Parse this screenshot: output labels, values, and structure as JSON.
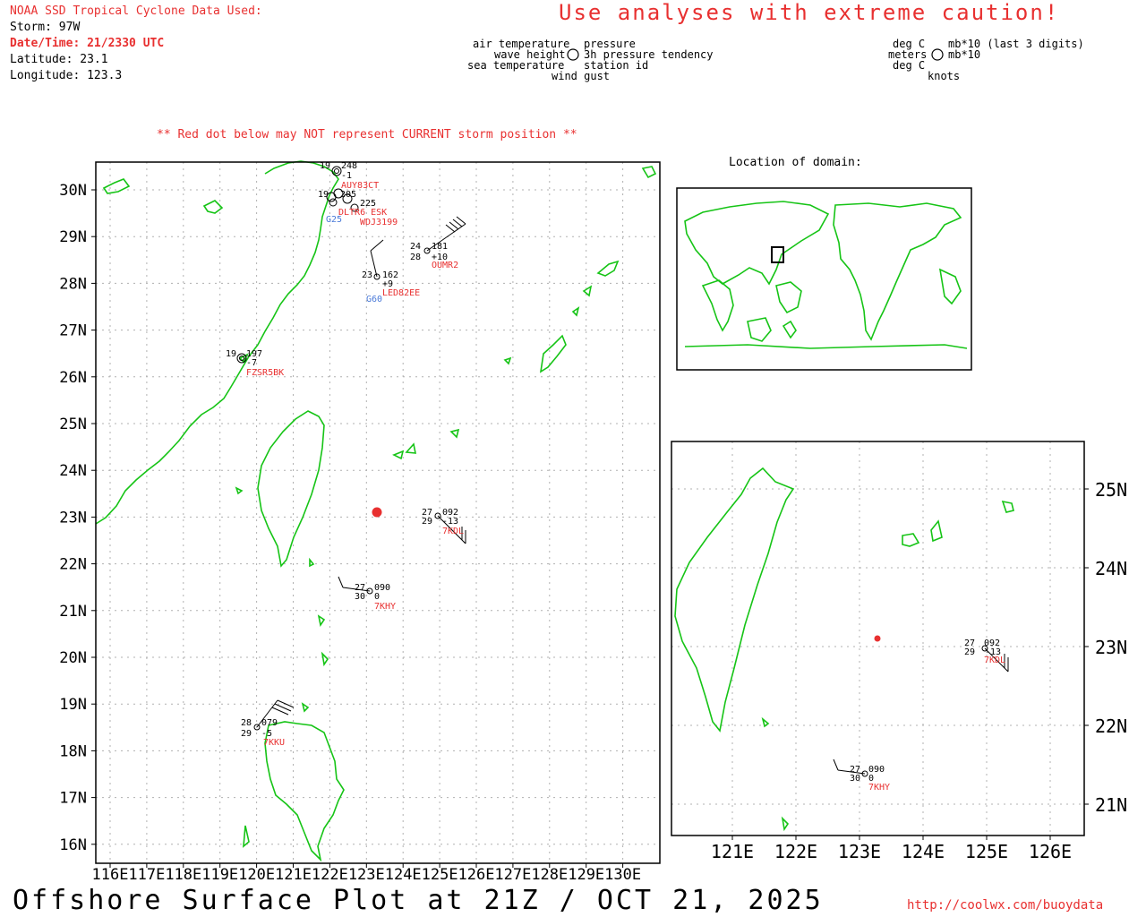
{
  "header": {
    "source": "NOAA SSD Tropical Cyclone Data Used:",
    "storm": "Storm: 97W",
    "datetime": "Date/Time: 21/2330 UTC",
    "latitude": "Latitude: 23.1",
    "longitude": "Longitude: 123.3",
    "caution": "Use analyses with extreme caution!"
  },
  "legend": {
    "air_temp": "air temperature",
    "pressure": "pressure",
    "wave_height": "wave height",
    "tendency": "3h pressure tendency",
    "sea_temp": "sea temperature",
    "station_id": "station id",
    "wind_gust": "wind gust",
    "deg_c_1": "deg C",
    "mb": "mb*10 (last 3 digits)",
    "meters": "meters",
    "mb2": "mb*10",
    "deg_c_2": "deg C",
    "knots": "knots"
  },
  "notes": {
    "red_dot": "** Red dot below may NOT represent CURRENT storm position **",
    "location": "Location of domain:"
  },
  "main_map": {
    "lat_labels": [
      "30N",
      "29N",
      "28N",
      "27N",
      "26N",
      "25N",
      "24N",
      "23N",
      "22N",
      "21N",
      "20N",
      "19N",
      "18N",
      "17N",
      "16N"
    ],
    "lon_labels": [
      "116E",
      "117E",
      "118E",
      "119E",
      "120E",
      "121E",
      "122E",
      "123E",
      "124E",
      "125E",
      "126E",
      "127E",
      "128E",
      "129E",
      "130E"
    ],
    "storm_color": "#e83030",
    "coast_color": "#16c416"
  },
  "zoom_map": {
    "lat_labels": [
      "25N",
      "24N",
      "23N",
      "22N",
      "21N"
    ],
    "lon_labels": [
      "121E",
      "122E",
      "123E",
      "124E",
      "125E",
      "126E"
    ]
  },
  "stations": [
    {
      "air": "19",
      "pres": "248",
      "tend": "-1",
      "id": "AUY83CT"
    },
    {
      "air": "19",
      "pres": "205",
      "tend": "",
      "id": "DLTR6 ESK"
    },
    {
      "air": "",
      "pres": "225",
      "tend": "",
      "id": "WDJ3199"
    },
    {
      "air": "",
      "pres": "",
      "tend": "",
      "id": "G25"
    },
    {
      "air": "24",
      "pres": "181",
      "sea": "28",
      "tend": "+10",
      "id": "OUMR2"
    },
    {
      "air": "23",
      "pres": "162",
      "tend": "+9",
      "id": "LED82EE"
    },
    {
      "air": "",
      "pres": "",
      "tend": "",
      "id": "G60"
    },
    {
      "air": "19",
      "pres": "197",
      "tend": "-7",
      "id": "FZSR5BK"
    },
    {
      "air": "27",
      "pres": "092",
      "sea": "29",
      "tend": "-13",
      "id": "7KDL"
    },
    {
      "air": "27",
      "pres": "090",
      "sea": "30",
      "tend": "0",
      "id": "7KHY"
    },
    {
      "air": "28",
      "pres": "079",
      "sea": "29",
      "tend": "-5",
      "id": "7KKU"
    }
  ],
  "footer": {
    "title": "Offshore Surface Plot at 21Z / OCT 21, 2025",
    "url": "http://coolwx.com/buoydata"
  }
}
